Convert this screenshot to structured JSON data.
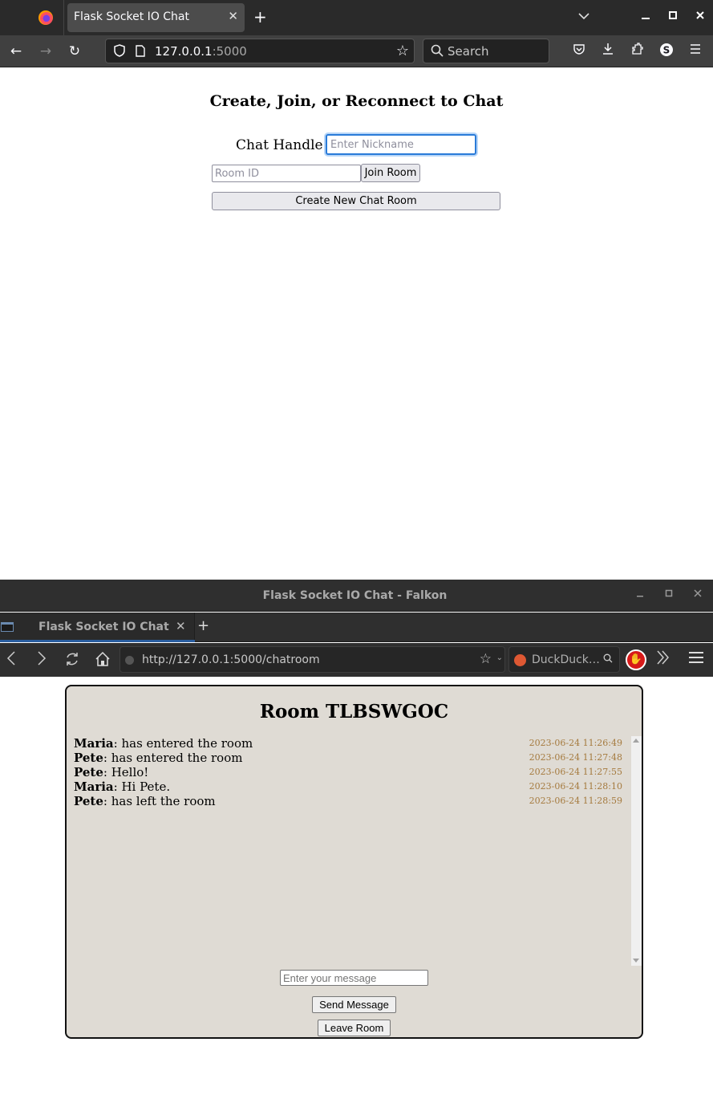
{
  "firefox": {
    "tab_title": "Flask Socket IO Chat",
    "url_host": "127.0.0.1",
    "url_port": ":5000",
    "search_placeholder": "Search",
    "page": {
      "heading": "Create, Join, or Reconnect to Chat",
      "handle_label": "Chat Handle:",
      "nickname_placeholder": "Enter Nickname",
      "nickname_value": "",
      "room_id_placeholder": "Room ID",
      "room_id_value": "",
      "join_button": "Join Room",
      "create_button": "Create New Chat Room"
    }
  },
  "falkon": {
    "window_title": "Flask Socket IO Chat - Falkon",
    "tab_title": "Flask Socket IO Chat",
    "url": "http://127.0.0.1:5000/chatroom",
    "search_engine_label": "DuckDuck…",
    "page": {
      "room_title": "Room TLBSWGOC",
      "messages": [
        {
          "user": "Maria",
          "text": ": has entered the room",
          "time": "2023-06-24 11:26:49"
        },
        {
          "user": "Pete",
          "text": ": has entered the room",
          "time": "2023-06-24 11:27:48"
        },
        {
          "user": "Pete",
          "text": ": Hello!",
          "time": "2023-06-24 11:27:55"
        },
        {
          "user": "Maria",
          "text": ": Hi Pete.",
          "time": "2023-06-24 11:28:10"
        },
        {
          "user": "Pete",
          "text": ": has left the room",
          "time": "2023-06-24 11:28:59"
        }
      ],
      "message_placeholder": "Enter your message",
      "message_value": "",
      "send_button": "Send Message",
      "leave_button": "Leave Room"
    }
  },
  "colors": {
    "chat_background": "#dfdbd4",
    "timestamp": "#a57a3e",
    "focus_ring": "#2a7bd8"
  }
}
